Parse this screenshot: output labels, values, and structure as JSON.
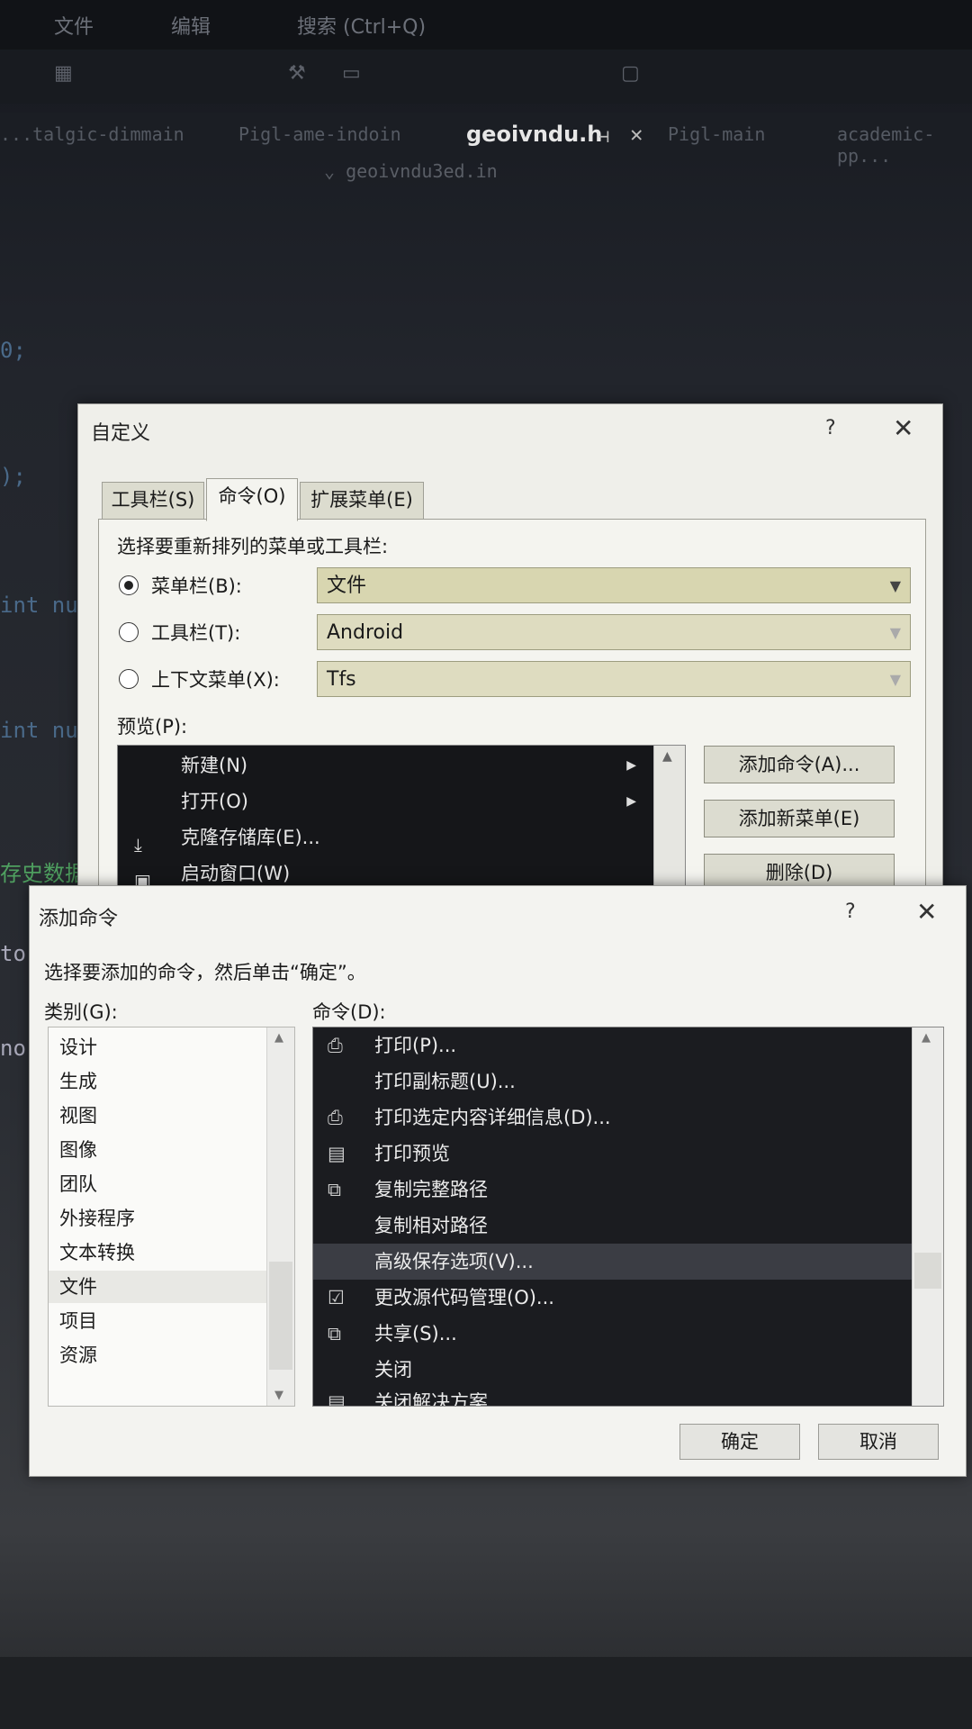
{
  "ide": {
    "menubar": [
      "文件",
      "编辑",
      "搜索 (Ctrl+Q)"
    ],
    "tabs": [
      "...talgic-dimmain",
      "Pigl-ame-indoin",
      "geoivndu.h",
      "Pigl-main",
      "academic-pp..."
    ],
    "active_tab": "geoivndu.h",
    "tab_pin_icon": "pin-icon",
    "tab_close_icon": "close-icon",
    "subtab": "geoivndu3ed.in",
    "code_lines": [
      "0;",
      ");",
      "int nu",
      "int nu",
      "存史数据",
      "tor",
      "no;"
    ]
  },
  "customize": {
    "title": "自定义",
    "help": "?",
    "close": "✕",
    "tabs": [
      {
        "label": "工具栏(S)",
        "active": false
      },
      {
        "label": "命令(O)",
        "active": true
      },
      {
        "label": "扩展菜单(E)",
        "active": false
      }
    ],
    "instruction": "选择要重新排列的菜单或工具栏:",
    "radios": [
      {
        "label": "菜单栏(B):",
        "selected": true,
        "value": "文件"
      },
      {
        "label": "工具栏(T):",
        "selected": false,
        "value": "Android"
      },
      {
        "label": "上下文菜单(X):",
        "selected": false,
        "value": "Tfs"
      }
    ],
    "preview_label": "预览(P):",
    "preview_items": [
      {
        "label": "新建(N)",
        "icon": "",
        "submenu": true
      },
      {
        "label": "打开(O)",
        "icon": "",
        "submenu": true
      },
      {
        "label": "克隆存储库(E)...",
        "icon": "download-icon",
        "submenu": false
      },
      {
        "label": "启动窗口(W)",
        "icon": "window-icon",
        "submenu": false
      }
    ],
    "buttons": [
      "添加命令(A)...",
      "添加新菜单(E)",
      "删除(D)"
    ]
  },
  "addcmd": {
    "title": "添加命令",
    "help": "?",
    "close": "✕",
    "instruction": "选择要添加的命令，然后单击“确定”。",
    "category_label": "类别(G):",
    "command_label": "命令(D):",
    "categories": [
      "设计",
      "生成",
      "视图",
      "图像",
      "团队",
      "外接程序",
      "文本转换",
      "文件",
      "项目",
      "资源"
    ],
    "selected_category": "文件",
    "commands": [
      {
        "label": "打印(P)...",
        "icon": "printer-icon"
      },
      {
        "label": "打印副标题(U)...",
        "icon": ""
      },
      {
        "label": "打印选定内容详细信息(D)...",
        "icon": "printer-icon"
      },
      {
        "label": "打印预览",
        "icon": "print-preview-icon"
      },
      {
        "label": "复制完整路径",
        "icon": "copy-icon"
      },
      {
        "label": "复制相对路径",
        "icon": ""
      },
      {
        "label": "高级保存选项(V)...",
        "icon": ""
      },
      {
        "label": "更改源代码管理(O)...",
        "icon": "source-control-icon"
      },
      {
        "label": "共享(S)...",
        "icon": "share-icon"
      },
      {
        "label": "关闭",
        "icon": ""
      },
      {
        "label": "关闭解决方案",
        "icon": "close-solution-icon"
      }
    ],
    "highlighted_command": "高级保存选项(V)...",
    "ok": "确定",
    "cancel": "取消"
  }
}
